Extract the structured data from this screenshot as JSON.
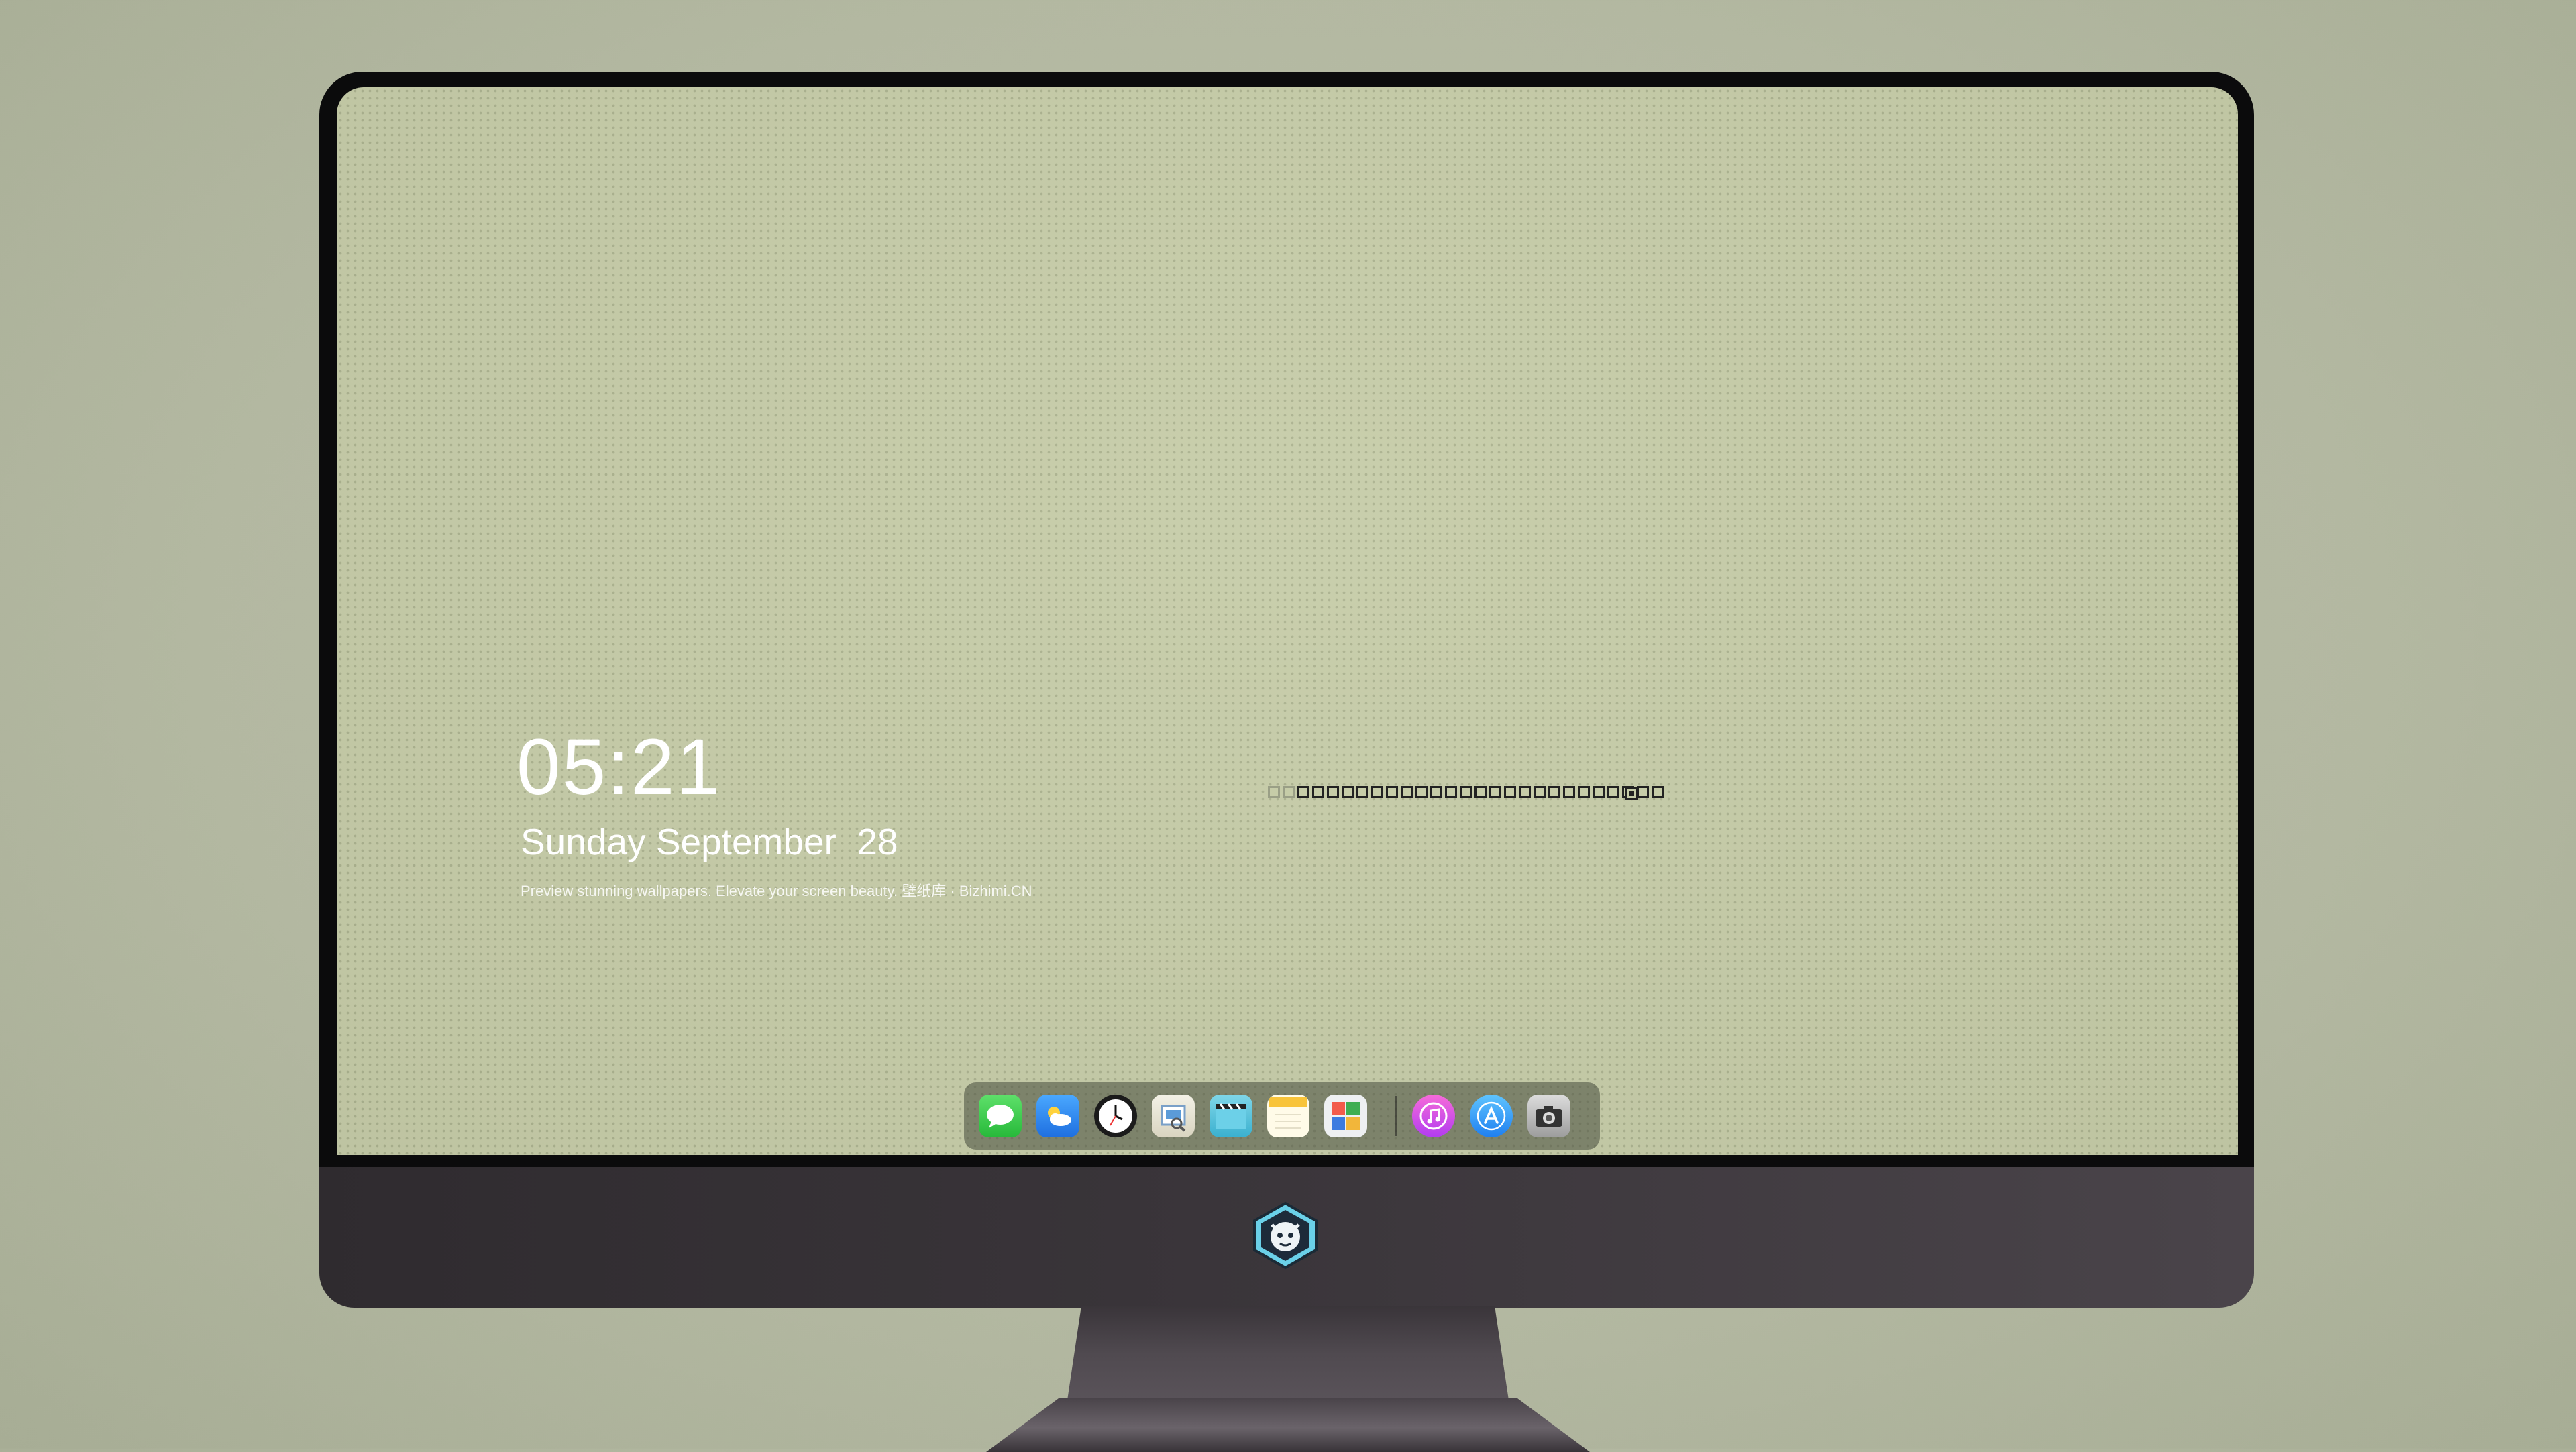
{
  "lockscreen": {
    "time": "05:21",
    "date": "Sunday September  28",
    "caption": "Preview stunning wallpapers. Elevate your screen beauty. 壁纸库 · Bizhimi.CN"
  },
  "progress": {
    "fraction": 0.94
  },
  "dock": {
    "apps": [
      "messages-icon",
      "weather-icon",
      "clock-icon",
      "preview-icon",
      "final-cut-icon",
      "notes-icon",
      "photo-grid-icon"
    ],
    "apps_right": [
      "music-icon",
      "app-store-icon",
      "camera-icon"
    ]
  },
  "colors": {
    "screen": "#c6cca8",
    "background": "#b3b8a1",
    "bezel": "#0b0b0c"
  }
}
